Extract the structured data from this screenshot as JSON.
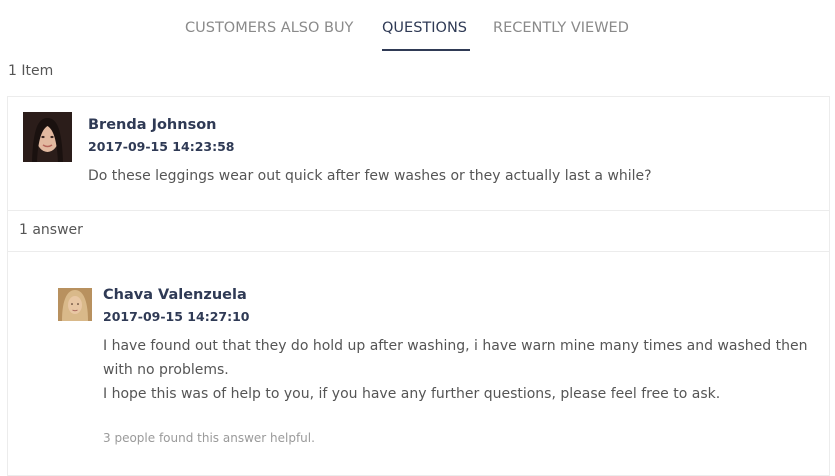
{
  "tabs": {
    "customers_also_buy": "CUSTOMERS ALSO BUY",
    "questions": "QUESTIONS",
    "recently_viewed": "RECENTLY VIEWED"
  },
  "items_count": "1 Item",
  "question": {
    "author": "Brenda Johnson",
    "date": "2017-09-15 14:23:58",
    "text": "Do these leggings wear out quick after few washes or they actually last a while?"
  },
  "answers_count": "1 answer",
  "answer": {
    "author": "Chava Valenzuela",
    "date": "2017-09-15 14:27:10",
    "line1": "I have found out that they do hold up after washing, i have warn mine many times and washed then",
    "line2": "with no problems.",
    "line3": "I hope this was of help to you, if you have any further questions, please feel free to ask.",
    "helpful": "3 people found this answer helpful."
  },
  "colors": {
    "accent": "#2f3a55",
    "inactive_tab": "#8a8a8a",
    "border": "#ececec",
    "text": "#555555",
    "muted": "#9a9a9a"
  }
}
